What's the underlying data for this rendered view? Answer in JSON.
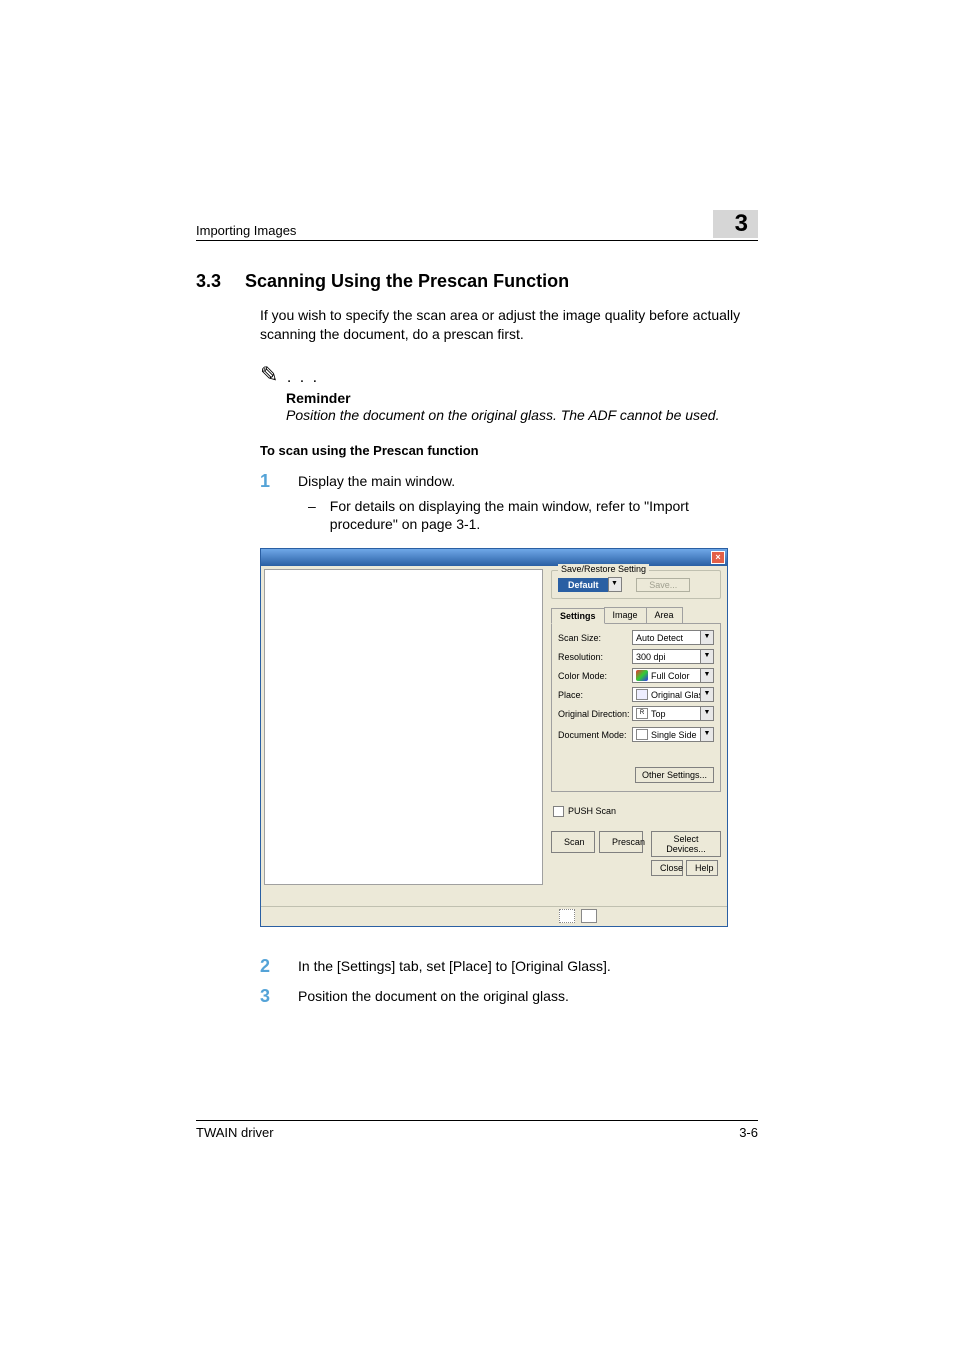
{
  "header": {
    "running_title": "Importing Images",
    "chapter_number": "3"
  },
  "section": {
    "number": "3.3",
    "title": "Scanning Using the Prescan Function",
    "intro": "If you wish to specify the scan area or adjust the image quality before actually scanning the document, do a prescan first."
  },
  "reminder": {
    "label": "Reminder",
    "text": "Position the document on the original glass. The ADF cannot be used."
  },
  "procedure_title": "To scan using the Prescan function",
  "steps": {
    "s1": {
      "num": "1",
      "text": "Display the main window.",
      "sub_dash": "–",
      "sub_text": "For details on displaying the main window, refer to \"Import procedure\" on page 3-1."
    },
    "s2": {
      "num": "2",
      "text": "In the [Settings] tab, set [Place] to [Original Glass]."
    },
    "s3": {
      "num": "3",
      "text": "Position the document on the original glass."
    }
  },
  "dialog": {
    "save_restore_label": "Save/Restore Setting",
    "default_btn": "Default",
    "save_btn": "Save...",
    "tabs": {
      "settings": "Settings",
      "image": "Image",
      "area": "Area"
    },
    "fields": {
      "scan_size": {
        "label": "Scan Size:",
        "value": "Auto Detect"
      },
      "resolution": {
        "label": "Resolution:",
        "value": "300 dpi"
      },
      "color_mode": {
        "label": "Color Mode:",
        "value": "Full Color"
      },
      "place": {
        "label": "Place:",
        "value": "Original Glass"
      },
      "orig_dir": {
        "label": "Original Direction:",
        "value": "Top"
      },
      "doc_mode": {
        "label": "Document Mode:",
        "value": "Single Side"
      }
    },
    "other_settings": "Other Settings...",
    "push_scan": "PUSH Scan",
    "buttons": {
      "scan": "Scan",
      "prescan": "Prescan",
      "select_devices": "Select Devices...",
      "close": "Close",
      "help": "Help"
    }
  },
  "footer": {
    "left": "TWAIN driver",
    "right": "3-6"
  }
}
